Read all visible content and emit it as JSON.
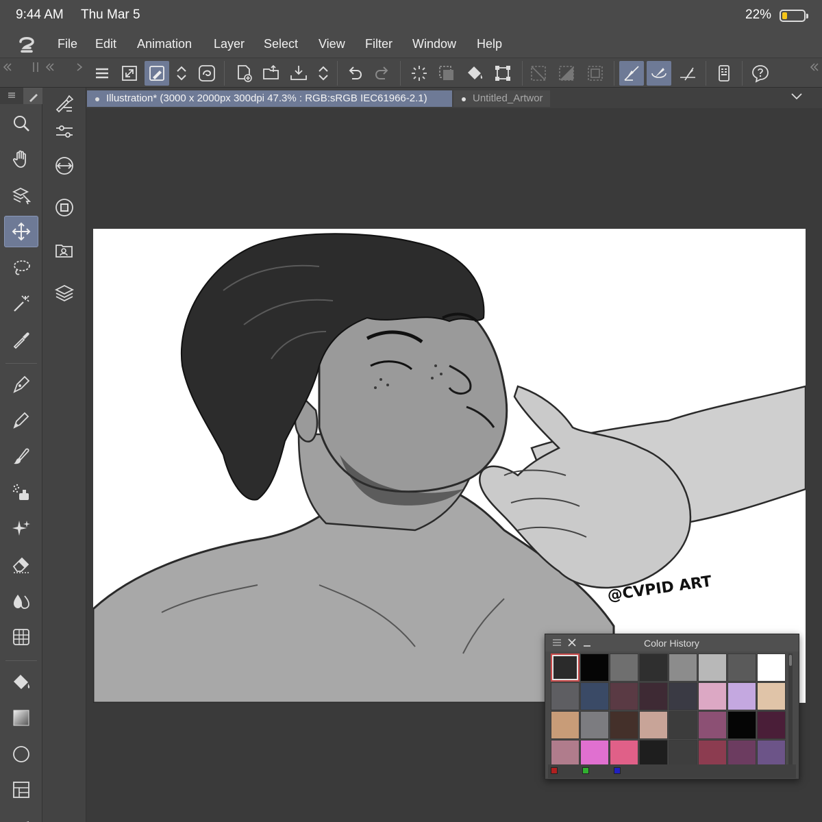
{
  "status": {
    "time": "9:44 AM",
    "date": "Thu Mar 5",
    "battery_text": "22%",
    "battery_level": 0.22,
    "battery_color": "#f5c518"
  },
  "menu": [
    "File",
    "Edit",
    "Animation",
    "Layer",
    "Select",
    "View",
    "Filter",
    "Window",
    "Help"
  ],
  "toolbar": {
    "active_color": "#6e7a96",
    "icons": [
      "menu-icon",
      "fit-screen-icon",
      "modify-icon",
      "spinner-icon",
      "companion-icon",
      "new-canvas-icon",
      "open-icon",
      "save-icon",
      "spinner-icon",
      "undo-icon",
      "redo-icon",
      "clear-selection-icon",
      "select-all-icon",
      "fill-icon",
      "transform-icon",
      "invert-selection-icon",
      "deselect-icon",
      "selection-border-icon",
      "snap-ruler-icon",
      "snap-special-ruler-icon",
      "snap-grid-icon",
      "device-settings-icon",
      "help-icon"
    ]
  },
  "tools": [
    "zoom-icon",
    "hand-icon",
    "layer-select-icon",
    "move-icon",
    "lasso-icon",
    "magic-wand-icon",
    "eyedropper-icon",
    "pen-icon",
    "pencil-icon",
    "brush-icon",
    "airbrush-icon",
    "decoration-icon",
    "eraser-icon",
    "blend-icon",
    "fill-tool-icon",
    "gradient-icon",
    "figure-icon",
    "frame-icon",
    "ruler-icon"
  ],
  "subpanels": [
    "tool-property-icon",
    "brush-size-icon",
    "navigator-icon",
    "color-wheel-icon",
    "material-icon",
    "layers-icon"
  ],
  "tabs": {
    "active": "Illustration* (3000 x 2000px 300dpi 47.3% : RGB:sRGB IEC61966-2.1)",
    "inactive": "Untitled_Artwor"
  },
  "artwork": {
    "watermark": "@CVPID ART"
  },
  "color_history": {
    "title": "Color History",
    "selected_index": 0,
    "swatches": [
      "#2b2b2b",
      "#050505",
      "#6f6f6f",
      "#2f2f2f",
      "#8c8c8c",
      "#b8b8b8",
      "#5a5a5a",
      "#ffffff",
      "#5e5e62",
      "#3a4a66",
      "#5a3a44",
      "#3e2a34",
      "#3a3a44",
      "#dca8c4",
      "#c4a8e0",
      "#e0c4a8",
      "#c89c78",
      "#7c7c80",
      "#44302a",
      "#c8a498",
      "#3c3c3c",
      "#8c5074",
      "#050505",
      "#4a1e38",
      "#b07c8c",
      "#e070d0",
      "#e06088",
      "#1e1e1e",
      "#3e3e3e",
      "#8c3c50",
      "#6c3c60",
      "#6c5488"
    ],
    "rgb_chips": [
      "#b02020",
      "#30b030",
      "#2020c0"
    ]
  }
}
